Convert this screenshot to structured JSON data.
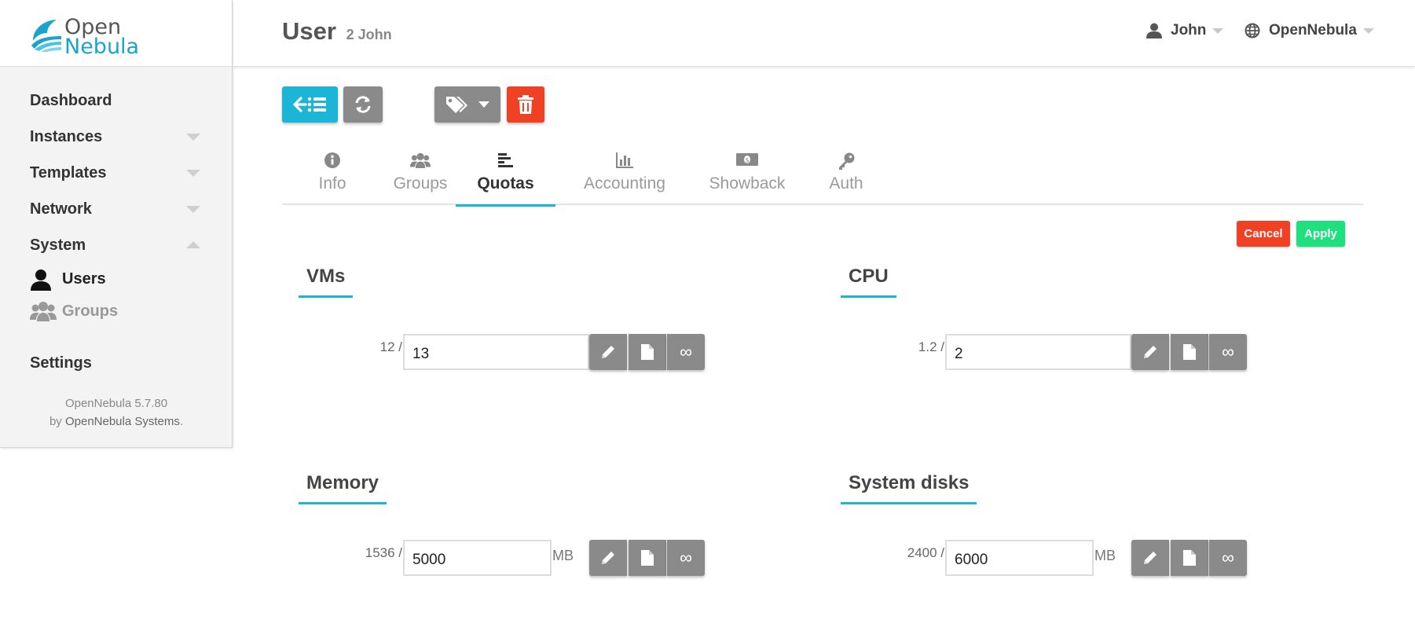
{
  "app": {
    "logo_line1": "Open",
    "logo_line2": "Nebula",
    "brand_color": "#1aa3cf",
    "accent_color": "#1bb5d6"
  },
  "sidebar": {
    "items": [
      {
        "label": "Dashboard"
      },
      {
        "label": "Instances"
      },
      {
        "label": "Templates"
      },
      {
        "label": "Network"
      },
      {
        "label": "System"
      }
    ],
    "system_children": [
      {
        "label": "Users",
        "icon": "user-icon"
      },
      {
        "label": "Groups",
        "icon": "groups-icon"
      }
    ],
    "settings_label": "Settings",
    "footer_version": "OpenNebula 5.7.80",
    "footer_by": "by",
    "footer_company": "OpenNebula Systems",
    "footer_dot": "."
  },
  "header": {
    "title": "User",
    "subtitle": "2 John",
    "user_name": "John",
    "zone_name": "OpenNebula"
  },
  "tabs": [
    {
      "label": "Info",
      "icon": "info-icon"
    },
    {
      "label": "Groups",
      "icon": "groups-icon"
    },
    {
      "label": "Quotas",
      "icon": "quotas-icon",
      "active": true
    },
    {
      "label": "Accounting",
      "icon": "chart-icon"
    },
    {
      "label": "Showback",
      "icon": "money-icon"
    },
    {
      "label": "Auth",
      "icon": "key-icon"
    }
  ],
  "actions": {
    "cancel": "Cancel",
    "apply": "Apply",
    "cancel_color": "#f04124",
    "apply_color": "#1ee07e"
  },
  "quotas": {
    "vms": {
      "title": "VMs",
      "used": "12 /",
      "value": "13"
    },
    "cpu": {
      "title": "CPU",
      "used": "1.2 /",
      "value": "2"
    },
    "memory": {
      "title": "Memory",
      "used": "1536 /",
      "value": "5000",
      "unit": "MB"
    },
    "system_disks": {
      "title": "System disks",
      "used": "2400 /",
      "value": "6000",
      "unit": "MB"
    },
    "unlimited_symbol": "∞"
  }
}
